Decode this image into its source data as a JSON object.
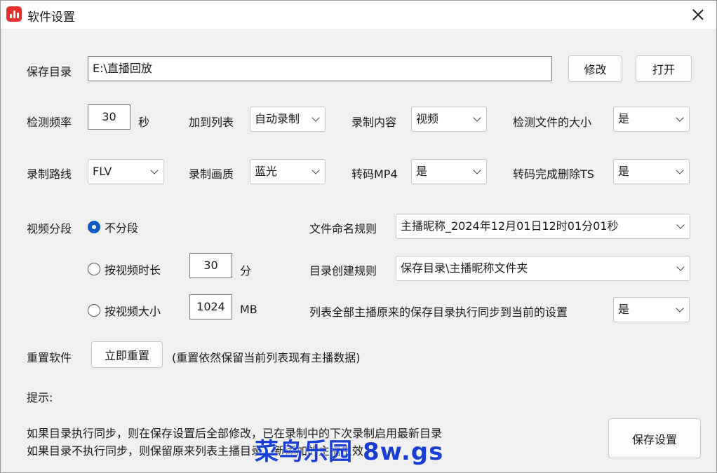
{
  "window": {
    "title": "软件设置"
  },
  "save_dir": {
    "label": "保存目录",
    "value": "E:\\直播回放",
    "modify_label": "修改",
    "open_label": "打开"
  },
  "row2": {
    "detect_freq_label": "检测频率",
    "detect_freq_value": "30",
    "detect_freq_unit": "秒",
    "add_list_label": "加到列表",
    "add_list_value": "自动录制",
    "record_content_label": "录制内容",
    "record_content_value": "视频",
    "detect_size_label": "检测文件的大小",
    "detect_size_value": "是"
  },
  "row3": {
    "route_label": "录制路线",
    "route_value": "FLV",
    "quality_label": "录制画质",
    "quality_value": "蓝光",
    "mp4_label": "转码MP4",
    "mp4_value": "是",
    "del_ts_label": "转码完成删除TS",
    "del_ts_value": "是"
  },
  "segment": {
    "label": "视频分段",
    "opt_none": "不分段",
    "opt_duration": "按视频时长",
    "duration_value": "30",
    "duration_unit": "分",
    "opt_size": "按视频大小",
    "size_value": "1024",
    "size_unit": "MB"
  },
  "naming": {
    "label": "文件命名规则",
    "value": "主播昵称_2024年12月01日12时01分01秒"
  },
  "dir_rule": {
    "label": "目录创建规则",
    "value": "保存目录\\主播昵称文件夹"
  },
  "sync": {
    "label": "列表全部主播原来的保存目录执行同步到当前的设置",
    "value": "是"
  },
  "reset": {
    "label": "重置软件",
    "button": "立即重置",
    "note": "(重置依然保留当前列表现有主播数据)"
  },
  "tips": {
    "title": "提示:",
    "line1": "如果目录执行同步，则在保存设置后全部修改，已在录制中的下次录制启用最新目录",
    "line2": "如果目录不执行同步，则保留原来列表主播目录，新添加的主播生效"
  },
  "save_button": "保存设置",
  "watermark": {
    "part1": "菜鸟乐园",
    "part2": "8w.gs"
  },
  "colors": {
    "accent": "#0a5fc7",
    "app_icon": "#e8312f",
    "watermark": "#1a3fd6"
  }
}
